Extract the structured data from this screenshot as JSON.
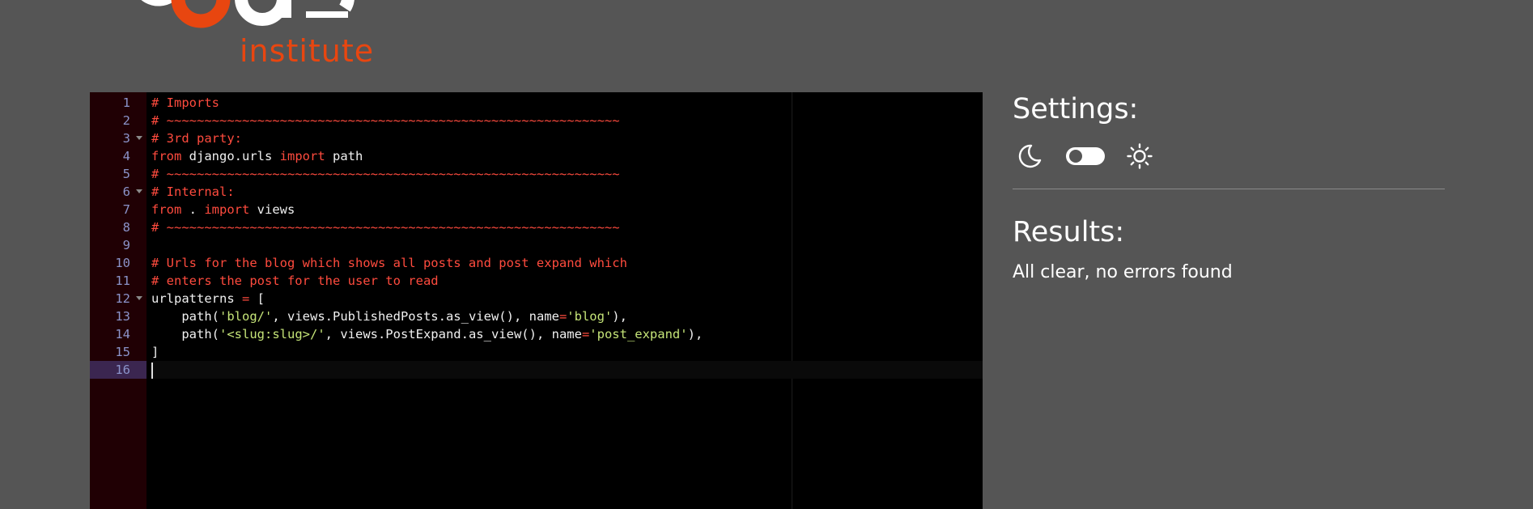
{
  "brand": {
    "logo_word": "code",
    "logo_sub": "institute",
    "colors": {
      "white": "#ffffff",
      "orange": "#e84610"
    }
  },
  "editor": {
    "active_line": 16,
    "colors": {
      "background": "#000000",
      "gutter": "#200004",
      "active_gutter": "#3b2650",
      "line_number": "#8b93c9",
      "comment": "#ff4b3e",
      "keyword": "#ff4b3e",
      "string": "#c5e478",
      "text": "#f0f0f0"
    },
    "lines": [
      {
        "number": "1",
        "fold": false,
        "tokens": [
          {
            "t": "comment",
            "v": "# Imports"
          }
        ]
      },
      {
        "number": "2",
        "fold": false,
        "tokens": [
          {
            "t": "comment",
            "v": "# ~~~~~~~~~~~~~~~~~~~~~~~~~~~~~~~~~~~~~~~~~~~~~~~~~~~~~~~~~~~~"
          }
        ]
      },
      {
        "number": "3",
        "fold": true,
        "tokens": [
          {
            "t": "comment",
            "v": "# 3rd party:"
          }
        ]
      },
      {
        "number": "4",
        "fold": false,
        "tokens": [
          {
            "t": "keyword",
            "v": "from"
          },
          {
            "t": "plain",
            "v": " django.urls "
          },
          {
            "t": "keyword",
            "v": "import"
          },
          {
            "t": "plain",
            "v": " path"
          }
        ]
      },
      {
        "number": "5",
        "fold": false,
        "tokens": [
          {
            "t": "comment",
            "v": "# ~~~~~~~~~~~~~~~~~~~~~~~~~~~~~~~~~~~~~~~~~~~~~~~~~~~~~~~~~~~~"
          }
        ]
      },
      {
        "number": "6",
        "fold": true,
        "tokens": [
          {
            "t": "comment",
            "v": "# Internal:"
          }
        ]
      },
      {
        "number": "7",
        "fold": false,
        "tokens": [
          {
            "t": "keyword",
            "v": "from"
          },
          {
            "t": "plain",
            "v": " . "
          },
          {
            "t": "keyword",
            "v": "import"
          },
          {
            "t": "plain",
            "v": " views"
          }
        ]
      },
      {
        "number": "8",
        "fold": false,
        "tokens": [
          {
            "t": "comment",
            "v": "# ~~~~~~~~~~~~~~~~~~~~~~~~~~~~~~~~~~~~~~~~~~~~~~~~~~~~~~~~~~~~"
          }
        ]
      },
      {
        "number": "9",
        "fold": false,
        "tokens": []
      },
      {
        "number": "10",
        "fold": false,
        "tokens": [
          {
            "t": "comment",
            "v": "# Urls for the blog which shows all posts and post expand which"
          }
        ]
      },
      {
        "number": "11",
        "fold": false,
        "tokens": [
          {
            "t": "comment",
            "v": "# enters the post for the user to read"
          }
        ]
      },
      {
        "number": "12",
        "fold": true,
        "tokens": [
          {
            "t": "plain",
            "v": "urlpatterns "
          },
          {
            "t": "operator",
            "v": "="
          },
          {
            "t": "plain",
            "v": " ["
          }
        ]
      },
      {
        "number": "13",
        "fold": false,
        "tokens": [
          {
            "t": "plain",
            "v": "    path("
          },
          {
            "t": "string",
            "v": "'blog/'"
          },
          {
            "t": "plain",
            "v": ", views.PublishedPosts.as_view(), name"
          },
          {
            "t": "operator",
            "v": "="
          },
          {
            "t": "string",
            "v": "'blog'"
          },
          {
            "t": "plain",
            "v": "),"
          }
        ]
      },
      {
        "number": "14",
        "fold": false,
        "tokens": [
          {
            "t": "plain",
            "v": "    path("
          },
          {
            "t": "string",
            "v": "'<slug:slug>/'"
          },
          {
            "t": "plain",
            "v": ", views.PostExpand.as_view(), name"
          },
          {
            "t": "operator",
            "v": "="
          },
          {
            "t": "string",
            "v": "'post_expand'"
          },
          {
            "t": "plain",
            "v": "),"
          }
        ]
      },
      {
        "number": "15",
        "fold": false,
        "tokens": [
          {
            "t": "plain",
            "v": "]"
          }
        ]
      },
      {
        "number": "16",
        "fold": false,
        "tokens": []
      }
    ]
  },
  "settings": {
    "heading": "Settings:",
    "theme_toggle": {
      "state": "off",
      "left_icon": "moon-icon",
      "right_icon": "sun-icon"
    }
  },
  "results": {
    "heading": "Results:",
    "message": "All clear, no errors found"
  },
  "colors": {
    "page_background": "#555555",
    "panel_text": "#ffffff",
    "divider": "#8a8a8a"
  }
}
